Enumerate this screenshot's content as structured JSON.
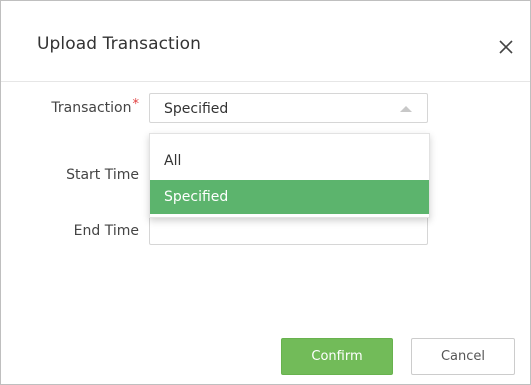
{
  "dialog": {
    "title": "Upload Transaction",
    "close_icon": "close-icon"
  },
  "form": {
    "transaction_label": "Transaction",
    "required_mark": "*",
    "transaction_value": "Specified",
    "start_time_label": "Start Time",
    "end_time_label": "End Time",
    "end_time_value": ""
  },
  "dropdown": {
    "options": [
      {
        "label": "All",
        "selected": false
      },
      {
        "label": "Specified",
        "selected": true
      }
    ]
  },
  "buttons": {
    "confirm_label": "Confirm",
    "cancel_label": "Cancel"
  },
  "colors": {
    "accent": "#72bb59",
    "selected_option": "#5cb46d",
    "required": "#e04040"
  }
}
